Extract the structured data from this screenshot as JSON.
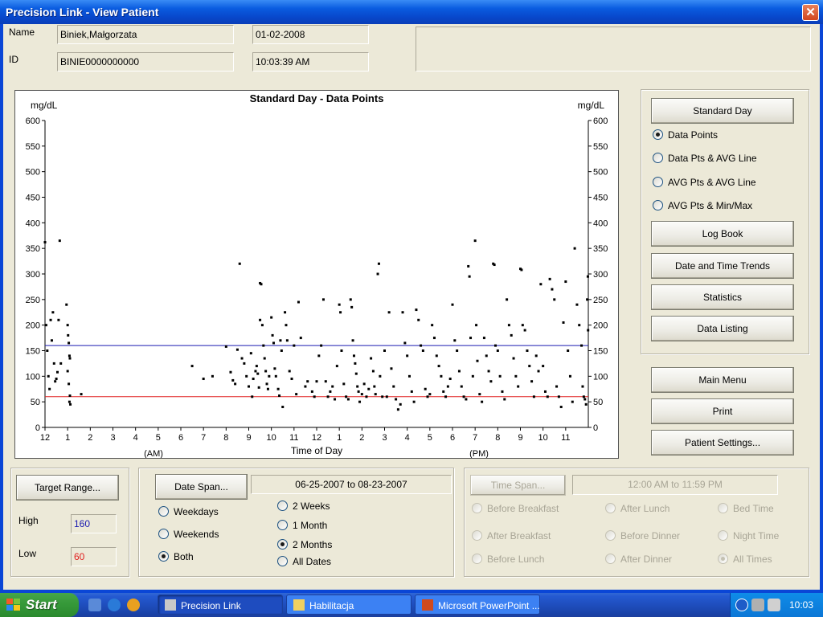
{
  "window": {
    "title": "Precision Link - View Patient",
    "close_glyph": "✕"
  },
  "patient": {
    "name_label": "Name",
    "name_value": "Biniek,Małgorzata",
    "id_label": "ID",
    "id_value": "BINIE0000000000",
    "date_value": "01-02-2008",
    "time_value": "10:03:39 AM"
  },
  "chart": {
    "title": "Standard Day - Data Points",
    "unit_left": "mg/dL",
    "unit_right": "mg/dL",
    "x_axis_title": "Time of Day",
    "am_label": "(AM)",
    "pm_label": "(PM)",
    "high_line_color": "#1a1ab0",
    "low_line_color": "#e02020"
  },
  "chart_data": {
    "type": "scatter",
    "title": "Standard Day - Data Points",
    "xlabel": "Time of Day",
    "ylabel": "mg/dL",
    "ylim": [
      0,
      600
    ],
    "xlim": [
      0,
      24
    ],
    "y_ticks": [
      0,
      50,
      100,
      150,
      200,
      250,
      300,
      350,
      400,
      450,
      500,
      550,
      600
    ],
    "x_ticks": [
      {
        "at": 0,
        "label": "12"
      },
      {
        "at": 1,
        "label": "1"
      },
      {
        "at": 2,
        "label": "2"
      },
      {
        "at": 3,
        "label": "3"
      },
      {
        "at": 4,
        "label": "4"
      },
      {
        "at": 5,
        "label": "5"
      },
      {
        "at": 6,
        "label": "6"
      },
      {
        "at": 7,
        "label": "7"
      },
      {
        "at": 8,
        "label": "8"
      },
      {
        "at": 9,
        "label": "9"
      },
      {
        "at": 10,
        "label": "10"
      },
      {
        "at": 11,
        "label": "11"
      },
      {
        "at": 12,
        "label": "12"
      },
      {
        "at": 13,
        "label": "1"
      },
      {
        "at": 14,
        "label": "2"
      },
      {
        "at": 15,
        "label": "3"
      },
      {
        "at": 16,
        "label": "4"
      },
      {
        "at": 17,
        "label": "5"
      },
      {
        "at": 18,
        "label": "6"
      },
      {
        "at": 19,
        "label": "7"
      },
      {
        "at": 20,
        "label": "8"
      },
      {
        "at": 21,
        "label": "9"
      },
      {
        "at": 22,
        "label": "10"
      },
      {
        "at": 23,
        "label": "11"
      }
    ],
    "reference_lines": [
      {
        "name": "High",
        "y": 160,
        "color": "#1a1ab0"
      },
      {
        "name": "Low",
        "y": 60,
        "color": "#e02020"
      }
    ],
    "grid": false,
    "points": [
      [
        0.0,
        362
      ],
      [
        0.05,
        200
      ],
      [
        0.1,
        150
      ],
      [
        0.15,
        100
      ],
      [
        0.2,
        75
      ],
      [
        0.25,
        210
      ],
      [
        0.3,
        170
      ],
      [
        0.35,
        225
      ],
      [
        0.4,
        125
      ],
      [
        0.45,
        90
      ],
      [
        0.5,
        95
      ],
      [
        0.55,
        108
      ],
      [
        0.6,
        210
      ],
      [
        0.65,
        365
      ],
      [
        0.7,
        125
      ],
      [
        0.95,
        240
      ],
      [
        1.0,
        200
      ],
      [
        1.02,
        180
      ],
      [
        1.05,
        165
      ],
      [
        1.08,
        140
      ],
      [
        1.1,
        135
      ],
      [
        1.0,
        110
      ],
      [
        1.05,
        85
      ],
      [
        1.1,
        62
      ],
      [
        1.08,
        50
      ],
      [
        1.12,
        45
      ],
      [
        1.6,
        65
      ],
      [
        6.5,
        120
      ],
      [
        7.0,
        95
      ],
      [
        7.4,
        100
      ],
      [
        8.0,
        158
      ],
      [
        8.2,
        108
      ],
      [
        8.3,
        92
      ],
      [
        8.4,
        85
      ],
      [
        8.5,
        152
      ],
      [
        8.6,
        320
      ],
      [
        8.7,
        135
      ],
      [
        8.8,
        125
      ],
      [
        8.9,
        100
      ],
      [
        9.0,
        80
      ],
      [
        9.1,
        145
      ],
      [
        9.15,
        60
      ],
      [
        9.2,
        95
      ],
      [
        9.3,
        110
      ],
      [
        9.35,
        120
      ],
      [
        9.4,
        105
      ],
      [
        9.45,
        78
      ],
      [
        9.5,
        210
      ],
      [
        9.5,
        282
      ],
      [
        9.55,
        280
      ],
      [
        9.6,
        200
      ],
      [
        9.65,
        160
      ],
      [
        9.7,
        135
      ],
      [
        9.75,
        110
      ],
      [
        9.8,
        85
      ],
      [
        9.85,
        75
      ],
      [
        9.9,
        100
      ],
      [
        10.0,
        215
      ],
      [
        10.05,
        180
      ],
      [
        10.1,
        165
      ],
      [
        10.15,
        115
      ],
      [
        10.2,
        100
      ],
      [
        10.3,
        75
      ],
      [
        10.35,
        62
      ],
      [
        10.4,
        170
      ],
      [
        10.45,
        150
      ],
      [
        10.5,
        40
      ],
      [
        10.6,
        225
      ],
      [
        10.65,
        200
      ],
      [
        10.7,
        170
      ],
      [
        10.8,
        110
      ],
      [
        10.9,
        95
      ],
      [
        11.0,
        160
      ],
      [
        11.1,
        65
      ],
      [
        11.2,
        245
      ],
      [
        11.3,
        175
      ],
      [
        11.5,
        80
      ],
      [
        11.6,
        90
      ],
      [
        11.8,
        70
      ],
      [
        11.9,
        60
      ],
      [
        12.0,
        90
      ],
      [
        12.1,
        140
      ],
      [
        12.2,
        160
      ],
      [
        12.3,
        250
      ],
      [
        12.4,
        90
      ],
      [
        12.5,
        60
      ],
      [
        12.6,
        70
      ],
      [
        12.7,
        80
      ],
      [
        12.8,
        55
      ],
      [
        12.9,
        120
      ],
      [
        13.0,
        240
      ],
      [
        13.05,
        225
      ],
      [
        13.1,
        150
      ],
      [
        13.2,
        85
      ],
      [
        13.3,
        60
      ],
      [
        13.4,
        55
      ],
      [
        13.5,
        250
      ],
      [
        13.55,
        235
      ],
      [
        13.6,
        170
      ],
      [
        13.65,
        140
      ],
      [
        13.7,
        125
      ],
      [
        13.75,
        105
      ],
      [
        13.8,
        80
      ],
      [
        13.85,
        70
      ],
      [
        13.9,
        50
      ],
      [
        14.0,
        65
      ],
      [
        14.1,
        85
      ],
      [
        14.2,
        60
      ],
      [
        14.3,
        75
      ],
      [
        14.4,
        135
      ],
      [
        14.5,
        110
      ],
      [
        14.55,
        80
      ],
      [
        14.6,
        65
      ],
      [
        14.7,
        300
      ],
      [
        14.75,
        320
      ],
      [
        14.8,
        100
      ],
      [
        14.9,
        60
      ],
      [
        15.0,
        150
      ],
      [
        15.1,
        60
      ],
      [
        15.2,
        225
      ],
      [
        15.3,
        115
      ],
      [
        15.4,
        80
      ],
      [
        15.5,
        55
      ],
      [
        15.6,
        35
      ],
      [
        15.7,
        45
      ],
      [
        15.8,
        225
      ],
      [
        15.9,
        165
      ],
      [
        16.0,
        140
      ],
      [
        16.1,
        100
      ],
      [
        16.2,
        70
      ],
      [
        16.3,
        50
      ],
      [
        16.4,
        230
      ],
      [
        16.5,
        210
      ],
      [
        16.6,
        160
      ],
      [
        16.7,
        150
      ],
      [
        16.8,
        75
      ],
      [
        16.9,
        60
      ],
      [
        17.0,
        65
      ],
      [
        17.1,
        200
      ],
      [
        17.2,
        175
      ],
      [
        17.3,
        140
      ],
      [
        17.4,
        120
      ],
      [
        17.5,
        100
      ],
      [
        17.6,
        70
      ],
      [
        17.7,
        60
      ],
      [
        17.8,
        80
      ],
      [
        17.9,
        95
      ],
      [
        18.0,
        240
      ],
      [
        18.1,
        170
      ],
      [
        18.2,
        150
      ],
      [
        18.3,
        110
      ],
      [
        18.4,
        80
      ],
      [
        18.5,
        60
      ],
      [
        18.6,
        55
      ],
      [
        18.7,
        315
      ],
      [
        18.75,
        295
      ],
      [
        18.8,
        175
      ],
      [
        18.9,
        100
      ],
      [
        19.0,
        365
      ],
      [
        19.05,
        200
      ],
      [
        19.1,
        130
      ],
      [
        19.2,
        65
      ],
      [
        19.3,
        50
      ],
      [
        19.4,
        175
      ],
      [
        19.5,
        140
      ],
      [
        19.6,
        110
      ],
      [
        19.7,
        90
      ],
      [
        19.8,
        320
      ],
      [
        19.85,
        318
      ],
      [
        19.9,
        160
      ],
      [
        20.0,
        150
      ],
      [
        20.1,
        100
      ],
      [
        20.2,
        70
      ],
      [
        20.3,
        55
      ],
      [
        20.4,
        250
      ],
      [
        20.5,
        200
      ],
      [
        20.6,
        180
      ],
      [
        20.7,
        135
      ],
      [
        20.8,
        100
      ],
      [
        20.9,
        80
      ],
      [
        21.0,
        310
      ],
      [
        21.05,
        308
      ],
      [
        21.1,
        200
      ],
      [
        21.2,
        190
      ],
      [
        21.3,
        150
      ],
      [
        21.4,
        120
      ],
      [
        21.5,
        90
      ],
      [
        21.6,
        60
      ],
      [
        21.7,
        140
      ],
      [
        21.8,
        110
      ],
      [
        21.9,
        280
      ],
      [
        22.0,
        120
      ],
      [
        22.1,
        70
      ],
      [
        22.2,
        60
      ],
      [
        22.3,
        290
      ],
      [
        22.4,
        270
      ],
      [
        22.5,
        250
      ],
      [
        22.6,
        80
      ],
      [
        22.7,
        60
      ],
      [
        22.8,
        40
      ],
      [
        22.9,
        205
      ],
      [
        23.0,
        285
      ],
      [
        23.1,
        150
      ],
      [
        23.2,
        100
      ],
      [
        23.3,
        50
      ],
      [
        23.4,
        350
      ],
      [
        23.5,
        240
      ],
      [
        23.6,
        200
      ],
      [
        23.7,
        160
      ],
      [
        23.75,
        80
      ],
      [
        23.8,
        60
      ],
      [
        23.85,
        55
      ],
      [
        23.9,
        45
      ],
      [
        23.95,
        250
      ],
      [
        23.98,
        295
      ],
      [
        23.99,
        190
      ]
    ]
  },
  "display": {
    "standard_day": "Standard Day",
    "options": [
      {
        "label": "Data Points",
        "selected": true
      },
      {
        "label": "Data Pts & AVG Line",
        "selected": false
      },
      {
        "label": "AVG Pts & AVG Line",
        "selected": false
      },
      {
        "label": "AVG Pts & Min/Max",
        "selected": false
      }
    ],
    "log_book": "Log Book",
    "date_time_trends": "Date and Time Trends",
    "statistics": "Statistics",
    "data_listing": "Data Listing"
  },
  "nav": {
    "main_menu": "Main Menu",
    "print": "Print",
    "patient_settings": "Patient Settings..."
  },
  "target": {
    "button": "Target Range...",
    "high_label": "High",
    "high_value": "160",
    "high_color": "#1a1ab0",
    "low_label": "Low",
    "low_value": "60",
    "low_color": "#e02020"
  },
  "date_span": {
    "button": "Date Span...",
    "range": "06-25-2007  to  08-23-2007",
    "day_options": [
      {
        "label": "Weekdays",
        "selected": false
      },
      {
        "label": "Weekends",
        "selected": false
      },
      {
        "label": "Both",
        "selected": true
      }
    ],
    "span_options": [
      {
        "label": "2 Weeks",
        "selected": false
      },
      {
        "label": "1 Month",
        "selected": false
      },
      {
        "label": "2 Months",
        "selected": true
      },
      {
        "label": "All Dates",
        "selected": false
      }
    ]
  },
  "time_span": {
    "button": "Time Span...",
    "range": "12:00 AM  to  11:59 PM",
    "options": [
      {
        "label": "Before Breakfast",
        "selected": false
      },
      {
        "label": "After Lunch",
        "selected": false
      },
      {
        "label": "Bed Time",
        "selected": false
      },
      {
        "label": "After Breakfast",
        "selected": false
      },
      {
        "label": "Before Dinner",
        "selected": false
      },
      {
        "label": "Night Time",
        "selected": false
      },
      {
        "label": "Before Lunch",
        "selected": false
      },
      {
        "label": "After Dinner",
        "selected": false
      },
      {
        "label": "All Times",
        "selected": true
      }
    ]
  },
  "taskbar": {
    "start": "Start",
    "tasks": [
      {
        "label": "Precision Link",
        "active": true
      },
      {
        "label": "Habilitacja",
        "active": false
      },
      {
        "label": "Microsoft PowerPoint ...",
        "active": false
      }
    ],
    "clock": "10:03"
  }
}
